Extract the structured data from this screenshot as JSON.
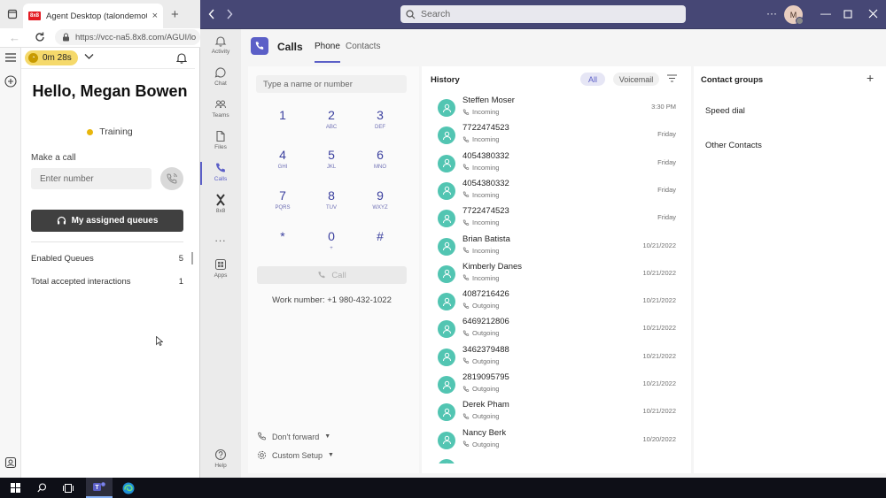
{
  "browser": {
    "tab_title": "Agent Desktop (talondemo01 - 8x8",
    "favicon_text": "8x8",
    "url": "https://vcc-na5.8x8.com/AGUI/lo"
  },
  "agent": {
    "timer": "0m 28s",
    "greeting": "Hello, Megan Bowen",
    "status": "Training",
    "make_call_label": "Make a call",
    "enter_number_placeholder": "Enter number",
    "queues_button": "My assigned queues",
    "stats": [
      {
        "label": "Enabled Queues",
        "value": "5"
      },
      {
        "label": "Total accepted interactions",
        "value": "1"
      }
    ]
  },
  "teams": {
    "search_placeholder": "Search",
    "avatar_initial": "M",
    "rail": [
      {
        "label": "Activity",
        "icon": "bell-icon"
      },
      {
        "label": "Chat",
        "icon": "chat-icon"
      },
      {
        "label": "Teams",
        "icon": "teams-icon"
      },
      {
        "label": "Files",
        "icon": "file-icon"
      },
      {
        "label": "Calls",
        "icon": "phone-icon"
      },
      {
        "label": "8x8",
        "icon": "8x8-icon"
      },
      {
        "label": "...",
        "icon": "more-icon"
      },
      {
        "label": "Apps",
        "icon": "apps-icon"
      },
      {
        "label": "Help",
        "icon": "help-icon"
      }
    ],
    "calls_title": "Calls",
    "tabs": [
      "Phone",
      "Contacts"
    ],
    "dial_placeholder": "Type a name or number",
    "keypad": [
      {
        "n": "1",
        "l": ""
      },
      {
        "n": "2",
        "l": "ABC"
      },
      {
        "n": "3",
        "l": "DEF"
      },
      {
        "n": "4",
        "l": "GHI"
      },
      {
        "n": "5",
        "l": "JKL"
      },
      {
        "n": "6",
        "l": "MNO"
      },
      {
        "n": "7",
        "l": "PQRS"
      },
      {
        "n": "8",
        "l": "TUV"
      },
      {
        "n": "9",
        "l": "WXYZ"
      },
      {
        "n": "*",
        "l": ""
      },
      {
        "n": "0",
        "l": "+"
      },
      {
        "n": "#",
        "l": ""
      }
    ],
    "call_button": "Call",
    "work_number": "Work number: +1 980-432-1022",
    "forward": "Don't forward",
    "custom_setup": "Custom Setup",
    "history_title": "History",
    "filter_all": "All",
    "filter_voicemail": "Voicemail",
    "history": [
      {
        "name": "Steffen Moser",
        "dir": "Incoming",
        "date": "3:30 PM"
      },
      {
        "name": "7722474523",
        "dir": "Incoming",
        "date": "Friday"
      },
      {
        "name": "4054380332",
        "dir": "Incoming",
        "date": "Friday"
      },
      {
        "name": "4054380332",
        "dir": "Incoming",
        "date": "Friday"
      },
      {
        "name": "7722474523",
        "dir": "Incoming",
        "date": "Friday"
      },
      {
        "name": "Brian Batista",
        "dir": "Incoming",
        "date": "10/21/2022"
      },
      {
        "name": "Kimberly Danes",
        "dir": "Incoming",
        "date": "10/21/2022"
      },
      {
        "name": "4087216426",
        "dir": "Outgoing",
        "date": "10/21/2022"
      },
      {
        "name": "6469212806",
        "dir": "Outgoing",
        "date": "10/21/2022"
      },
      {
        "name": "3462379488",
        "dir": "Outgoing",
        "date": "10/21/2022"
      },
      {
        "name": "2819095795",
        "dir": "Outgoing",
        "date": "10/21/2022"
      },
      {
        "name": "Derek Pham",
        "dir": "Outgoing",
        "date": "10/21/2022"
      },
      {
        "name": "Nancy Berk",
        "dir": "Outgoing",
        "date": "10/20/2022"
      },
      {
        "name": "",
        "dir": "",
        "date": ""
      }
    ],
    "contact_groups_title": "Contact groups",
    "contact_groups": [
      "Speed dial",
      "Other Contacts"
    ]
  },
  "colors": {
    "teams_titlebar": "#464775",
    "teams_accent": "#5b5fc7",
    "avatar_teal": "#52c5b2",
    "timer_yellow": "#f5d96b",
    "queues_button_bg": "#404040"
  }
}
